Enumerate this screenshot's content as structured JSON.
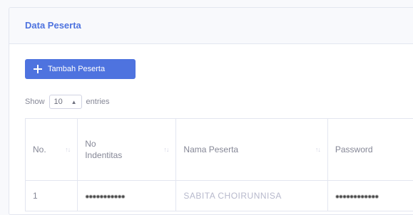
{
  "card": {
    "title": "Data Peserta"
  },
  "toolbar": {
    "add_label": "Tambah Peserta"
  },
  "length_control": {
    "show_label": "Show",
    "value": "10",
    "suffix": "entries"
  },
  "table": {
    "headers": [
      "No.",
      "No Indentitas",
      "Nama Peserta",
      "Password"
    ],
    "rows": [
      {
        "no": "1",
        "id": "●●●●●●●●●●●",
        "name": "SABITA CHOIRUNNISA",
        "password": "●●●●●●●●●●●●"
      }
    ]
  },
  "colors": {
    "primary": "#4e73df",
    "text_muted": "#858796",
    "border": "#e3e6f0"
  }
}
